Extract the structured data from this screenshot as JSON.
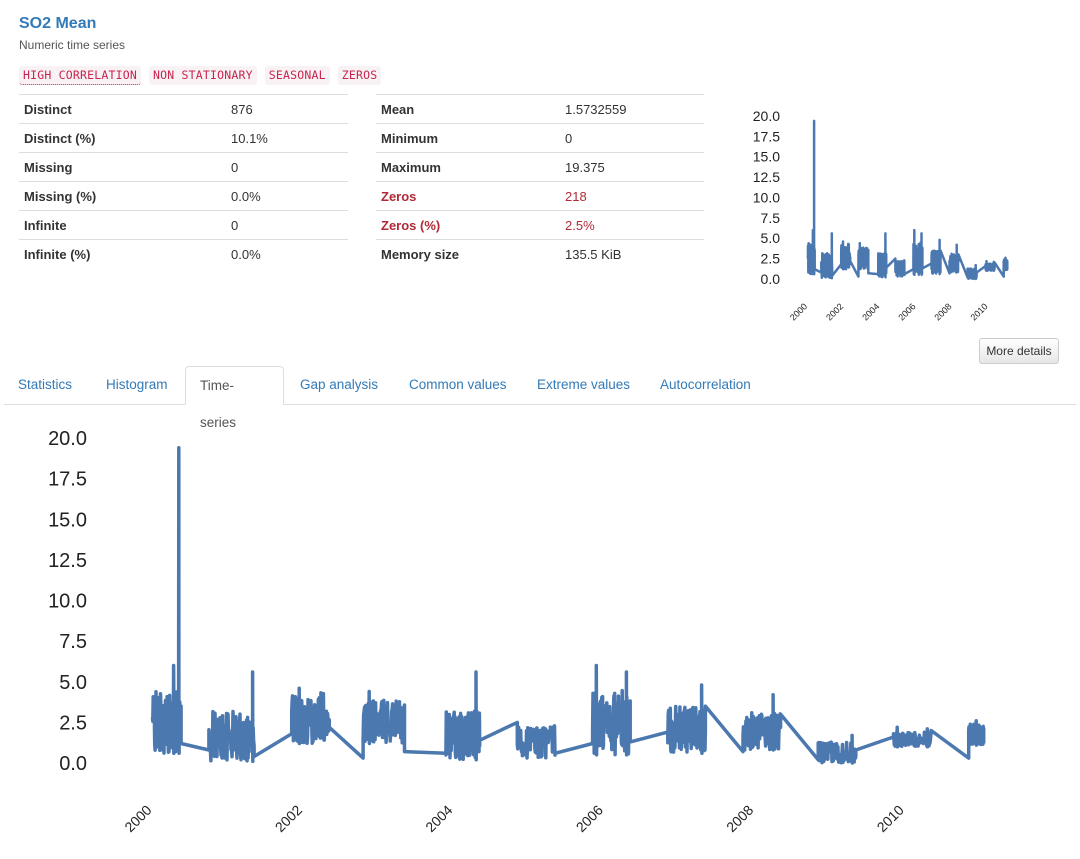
{
  "header": {
    "title": "SO2 Mean",
    "subtitle": "Numeric time series"
  },
  "badges": [
    "HIGH CORRELATION",
    "NON STATIONARY",
    "SEASONAL",
    "ZEROS"
  ],
  "stats_left": [
    {
      "key": "Distinct",
      "value": "876"
    },
    {
      "key": "Distinct (%)",
      "value": "10.1%"
    },
    {
      "key": "Missing",
      "value": "0"
    },
    {
      "key": "Missing (%)",
      "value": "0.0%"
    },
    {
      "key": "Infinite",
      "value": "0"
    },
    {
      "key": "Infinite (%)",
      "value": "0.0%"
    }
  ],
  "stats_right": [
    {
      "key": "Mean",
      "value": "1.5732559"
    },
    {
      "key": "Minimum",
      "value": "0"
    },
    {
      "key": "Maximum",
      "value": "19.375"
    },
    {
      "key": "Zeros",
      "value": "218"
    },
    {
      "key": "Zeros (%)",
      "value": "2.5%"
    },
    {
      "key": "Memory size",
      "value": "135.5 KiB"
    }
  ],
  "buttons": {
    "more_details": "More details"
  },
  "tabs": [
    {
      "label": "Statistics"
    },
    {
      "label": "Histogram"
    },
    {
      "label": "Time-series",
      "active": true
    },
    {
      "label": "Gap analysis"
    },
    {
      "label": "Common values"
    },
    {
      "label": "Extreme values"
    },
    {
      "label": "Autocorrelation"
    }
  ],
  "colors": {
    "accent": "#337ab7",
    "series": "#4c78b0",
    "alert": "#b02a37"
  },
  "chart_data": {
    "type": "line",
    "x_unit": "year",
    "x_ticks": [
      "2000",
      "2002",
      "2004",
      "2006",
      "2008",
      "2010"
    ],
    "y_ticks": [
      "0.0",
      "2.5",
      "5.0",
      "7.5",
      "10.0",
      "12.5",
      "15.0",
      "17.5",
      "20.0"
    ],
    "ylim": [
      0,
      20
    ],
    "xlim": [
      1999.9,
      2011.2
    ],
    "grid": false,
    "segments": [
      {
        "start": 2000.0,
        "end": 2000.38,
        "low": 0.6,
        "high": 4.4,
        "peaks": [
          [
            2000.28,
            6.0
          ],
          [
            2000.35,
            19.4
          ]
        ]
      },
      {
        "start": 2000.75,
        "end": 2001.35,
        "low": 0.1,
        "high": 3.2,
        "peaks": [
          [
            2001.33,
            5.6
          ]
        ]
      },
      {
        "start": 2001.85,
        "end": 2002.35,
        "low": 1.2,
        "high": 4.4,
        "peaks": [
          [
            2001.95,
            4.6
          ]
        ]
      },
      {
        "start": 2002.8,
        "end": 2003.35,
        "low": 1.2,
        "high": 3.9,
        "peaks": [
          [
            2002.88,
            4.4
          ]
        ]
      },
      {
        "start": 2003.9,
        "end": 2004.35,
        "low": 0.2,
        "high": 3.2,
        "peaks": [
          [
            2004.3,
            5.6
          ]
        ]
      },
      {
        "start": 2004.85,
        "end": 2005.35,
        "low": 0.3,
        "high": 2.3,
        "peaks": []
      },
      {
        "start": 2005.85,
        "end": 2006.35,
        "low": 0.5,
        "high": 4.5,
        "peaks": [
          [
            2005.9,
            6.0
          ],
          [
            2006.3,
            5.6
          ]
        ]
      },
      {
        "start": 2006.85,
        "end": 2007.35,
        "low": 0.6,
        "high": 3.5,
        "peaks": [
          [
            2007.3,
            4.8
          ]
        ]
      },
      {
        "start": 2007.85,
        "end": 2008.35,
        "low": 0.8,
        "high": 3.1,
        "peaks": [
          [
            2008.25,
            4.2
          ]
        ]
      },
      {
        "start": 2008.85,
        "end": 2009.35,
        "low": 0.0,
        "high": 1.3,
        "peaks": [
          [
            2009.3,
            1.7
          ]
        ]
      },
      {
        "start": 2009.85,
        "end": 2010.35,
        "low": 1.0,
        "high": 1.9,
        "peaks": [
          [
            2009.9,
            2.2
          ],
          [
            2010.3,
            2.1
          ]
        ]
      },
      {
        "start": 2010.85,
        "end": 2011.05,
        "low": 1.1,
        "high": 2.4,
        "peaks": [
          [
            2010.95,
            2.6
          ]
        ]
      }
    ],
    "connectors": [
      [
        2000.38,
        1.2
      ],
      [
        2000.75,
        0.8
      ],
      [
        2001.35,
        0.4
      ],
      [
        2001.85,
        1.8
      ],
      [
        2002.35,
        2.2
      ],
      [
        2002.8,
        0.3
      ],
      [
        2003.35,
        0.7
      ],
      [
        2003.9,
        0.6
      ],
      [
        2004.35,
        1.4
      ],
      [
        2004.85,
        2.5
      ],
      [
        2005.35,
        0.6
      ],
      [
        2005.85,
        1.2
      ],
      [
        2006.35,
        1.3
      ],
      [
        2006.85,
        1.9
      ],
      [
        2007.35,
        3.5
      ],
      [
        2007.85,
        0.7
      ],
      [
        2008.35,
        3.0
      ],
      [
        2008.85,
        0.2
      ],
      [
        2009.35,
        0.8
      ],
      [
        2009.85,
        1.6
      ],
      [
        2010.35,
        2.0
      ],
      [
        2010.85,
        0.3
      ],
      [
        2011.05,
        1.2
      ]
    ]
  }
}
